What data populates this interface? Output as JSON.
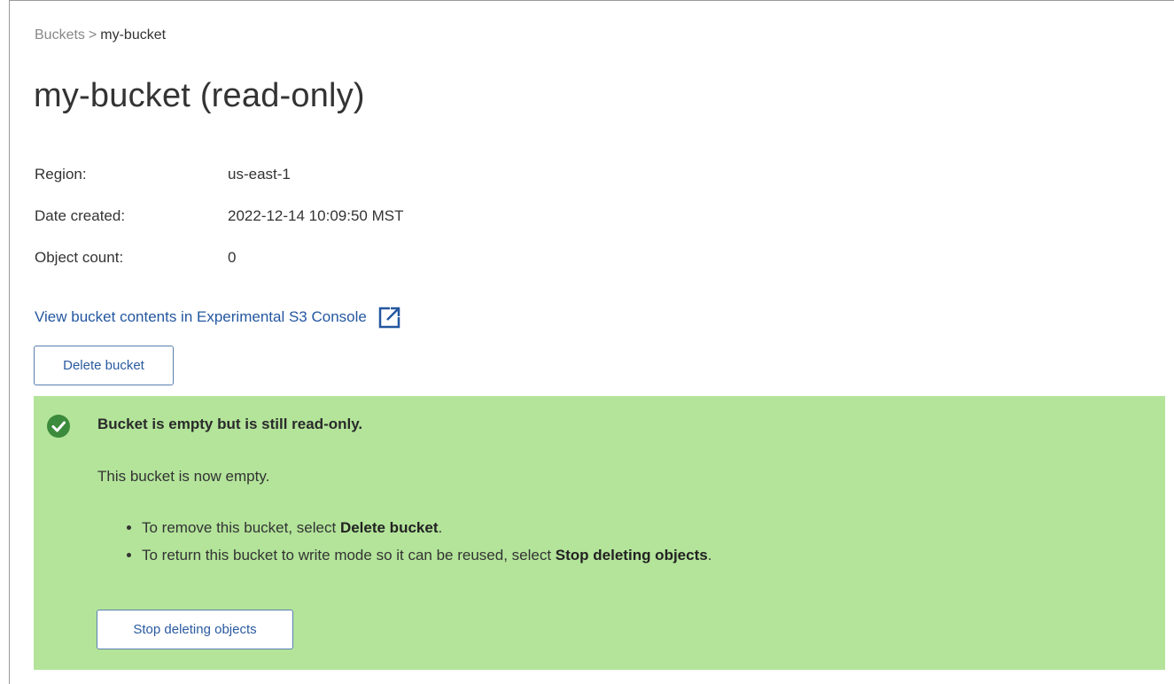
{
  "breadcrumb": {
    "parent": "Buckets",
    "separator": ">",
    "current": "my-bucket"
  },
  "page": {
    "title": "my-bucket (read-only)"
  },
  "details": [
    {
      "label": "Region:",
      "value": "us-east-1"
    },
    {
      "label": "Date created:",
      "value": "2022-12-14 10:09:50 MST"
    },
    {
      "label": "Object count:",
      "value": "0"
    }
  ],
  "console_link": {
    "label": "View bucket contents in Experimental S3 Console",
    "icon": "external-link-icon"
  },
  "actions": {
    "delete_bucket": "Delete bucket"
  },
  "alert": {
    "icon": "check-circle-icon",
    "title": "Bucket is empty but is still read-only.",
    "message": "This bucket is now empty.",
    "items": [
      {
        "before": "To remove this bucket, select ",
        "bold": "Delete bucket",
        "after": "."
      },
      {
        "before": "To return this bucket to write mode so it can be reused, select ",
        "bold": "Stop deleting objects",
        "after": "."
      }
    ],
    "button": "Stop deleting objects"
  },
  "colors": {
    "alert_bg": "#b3e49a",
    "success_icon": "#3c8a3c",
    "link": "#2457a0",
    "button_border": "#5a7fb2"
  }
}
